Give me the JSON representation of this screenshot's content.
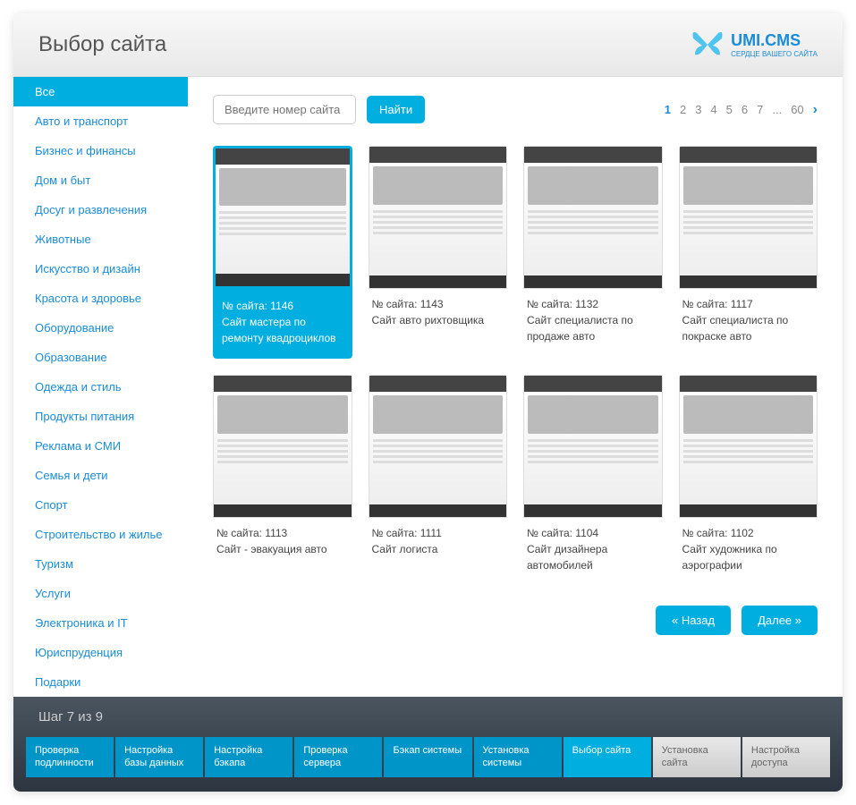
{
  "header": {
    "title": "Выбор сайта",
    "logo": "UMI.CMS",
    "logo_sub": "СЕРДЦЕ ВАШЕГО САЙТА"
  },
  "sidebar": {
    "items": [
      {
        "label": "Все",
        "active": true
      },
      {
        "label": "Авто и транспорт"
      },
      {
        "label": "Бизнес и финансы"
      },
      {
        "label": "Дом и быт"
      },
      {
        "label": "Досуг и развлечения"
      },
      {
        "label": "Животные"
      },
      {
        "label": "Искусство и дизайн"
      },
      {
        "label": "Красота и здоровье"
      },
      {
        "label": "Оборудование"
      },
      {
        "label": "Образование"
      },
      {
        "label": "Одежда и стиль"
      },
      {
        "label": "Продукты питания"
      },
      {
        "label": "Реклама и СМИ"
      },
      {
        "label": "Семья и дети"
      },
      {
        "label": "Спорт"
      },
      {
        "label": "Строительство и жилье"
      },
      {
        "label": "Туризм"
      },
      {
        "label": "Услуги"
      },
      {
        "label": "Электроника и IT"
      },
      {
        "label": "Юриспруденция"
      },
      {
        "label": "Подарки"
      }
    ]
  },
  "search": {
    "placeholder": "Введите номер сайта",
    "button": "Найти"
  },
  "pagination": {
    "pages": [
      "1",
      "2",
      "3",
      "4",
      "5",
      "6",
      "7",
      "...",
      "60"
    ],
    "active": 0
  },
  "cards": [
    {
      "num": "№ сайта: 1146",
      "title": "Сайт мастера по ремонту квадроциклов",
      "selected": true
    },
    {
      "num": "№ сайта: 1143",
      "title": "Сайт авто рихтовщика"
    },
    {
      "num": "№ сайта: 1132",
      "title": "Сайт специалиста по продаже авто"
    },
    {
      "num": "№ сайта: 1117",
      "title": "Сайт специалиста по покраске авто"
    },
    {
      "num": "№ сайта: 1113",
      "title": "Сайт - эвакуация авто"
    },
    {
      "num": "№ сайта: 1111",
      "title": "Сайт логиста"
    },
    {
      "num": "№ сайта: 1104",
      "title": "Сайт дизайнера автомобилей"
    },
    {
      "num": "№ сайта: 1102",
      "title": "Сайт художника по аэрографии"
    }
  ],
  "nav": {
    "back": "«   Назад",
    "next": "Далее   »"
  },
  "footer": {
    "step_label": "Шаг 7 из 9",
    "steps": [
      {
        "label": "Проверка подлинности",
        "state": "done"
      },
      {
        "label": "Настройка базы данных",
        "state": "done"
      },
      {
        "label": "Настройка бэкапа",
        "state": "done"
      },
      {
        "label": "Проверка сервера",
        "state": "done"
      },
      {
        "label": "Бэкап системы",
        "state": "done"
      },
      {
        "label": "Установка системы",
        "state": "done"
      },
      {
        "label": "Выбор сайта",
        "state": "active"
      },
      {
        "label": "Установка сайта",
        "state": "future"
      },
      {
        "label": "Настройка доступа",
        "state": "future"
      }
    ]
  }
}
